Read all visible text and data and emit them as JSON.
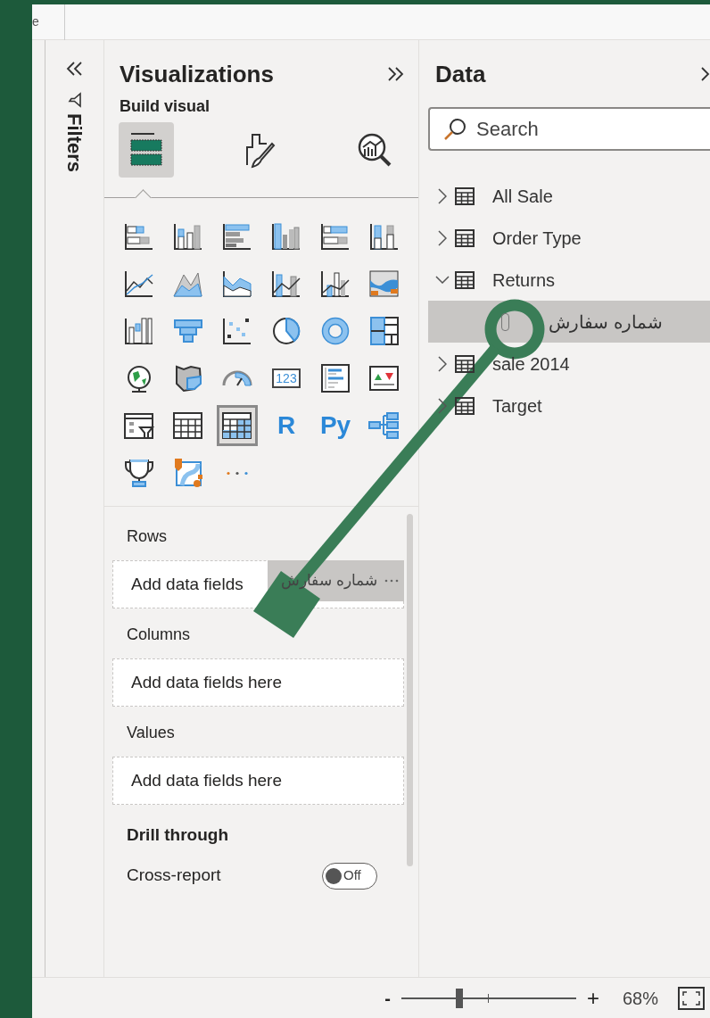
{
  "top_bar": {
    "cut_text": "e"
  },
  "filters_pane": {
    "title": "Filters"
  },
  "visualizations": {
    "title": "Visualizations",
    "subtitle": "Build visual",
    "build_tabs": [
      {
        "kind": "build",
        "selected": true
      },
      {
        "kind": "format",
        "selected": false
      },
      {
        "kind": "analytics",
        "selected": false
      }
    ],
    "gallery": [
      {
        "kind": "stacked-bar",
        "selected": false
      },
      {
        "kind": "stacked-column",
        "selected": false
      },
      {
        "kind": "clustered-bar",
        "selected": false
      },
      {
        "kind": "clustered-column",
        "selected": false
      },
      {
        "kind": "percent-bar",
        "selected": false
      },
      {
        "kind": "percent-column",
        "selected": false
      },
      {
        "kind": "line",
        "selected": false
      },
      {
        "kind": "area",
        "selected": false
      },
      {
        "kind": "stacked-area",
        "selected": false
      },
      {
        "kind": "line-column",
        "selected": false
      },
      {
        "kind": "line-clustered",
        "selected": false
      },
      {
        "kind": "ribbon",
        "selected": false
      },
      {
        "kind": "waterfall",
        "selected": false
      },
      {
        "kind": "funnel",
        "selected": false
      },
      {
        "kind": "scatter",
        "selected": false
      },
      {
        "kind": "pie",
        "selected": false
      },
      {
        "kind": "donut",
        "selected": false
      },
      {
        "kind": "treemap",
        "selected": false
      },
      {
        "kind": "globe",
        "selected": false
      },
      {
        "kind": "filled-map",
        "selected": false
      },
      {
        "kind": "gauge",
        "selected": false
      },
      {
        "kind": "card",
        "selected": false,
        "label": "123"
      },
      {
        "kind": "multirow-card",
        "selected": false
      },
      {
        "kind": "kpi",
        "selected": false
      },
      {
        "kind": "slicer",
        "selected": false
      },
      {
        "kind": "table",
        "selected": false
      },
      {
        "kind": "matrix",
        "selected": true
      },
      {
        "kind": "script",
        "selected": false,
        "label": "R"
      },
      {
        "kind": "script",
        "selected": false,
        "label": "Py"
      },
      {
        "kind": "decomposition",
        "selected": false
      },
      {
        "kind": "trophy",
        "selected": false
      },
      {
        "kind": "azure-map",
        "selected": false
      },
      {
        "kind": "more",
        "selected": false
      }
    ],
    "wells": [
      {
        "label": "Rows",
        "placeholder": "Add data fields",
        "drag_ghost": "شماره سفارش"
      },
      {
        "label": "Columns",
        "placeholder": "Add data fields here"
      },
      {
        "label": "Values",
        "placeholder": "Add data fields here"
      }
    ],
    "drill_through": {
      "title": "Drill through",
      "toggles": [
        {
          "label": "Cross-report",
          "on": false,
          "state_text": "Off"
        }
      ]
    }
  },
  "data_pane": {
    "title": "Data",
    "search": {
      "placeholder": "Search"
    },
    "tables": [
      {
        "name": "All Sale",
        "expanded": false
      },
      {
        "name": "Order Type",
        "expanded": false
      },
      {
        "name": "Returns",
        "expanded": true,
        "children": [
          {
            "name": "شماره سفارش",
            "selected": true
          }
        ]
      },
      {
        "name": "sale 2014",
        "expanded": false
      },
      {
        "name": "Target",
        "expanded": false
      }
    ]
  },
  "status_bar": {
    "zoom_minus": "-",
    "zoom_plus": "+",
    "level": 0.33,
    "zoom_percent": "68%"
  }
}
